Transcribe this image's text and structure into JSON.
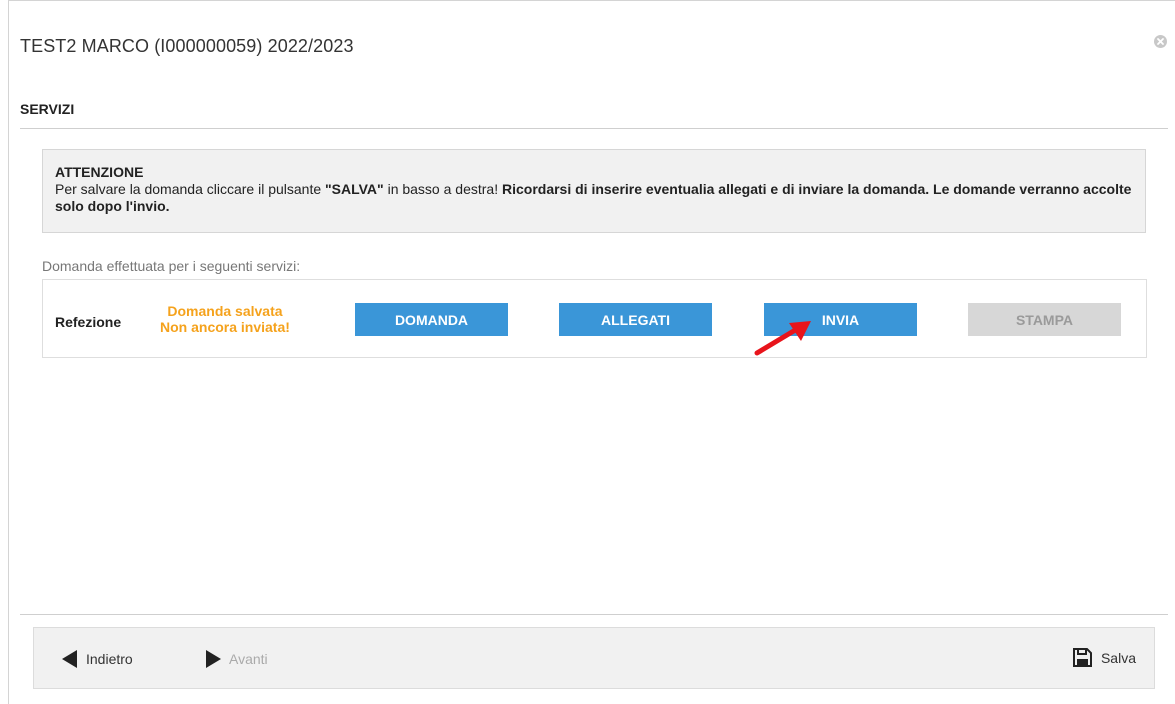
{
  "dialog": {
    "title": "TEST2 MARCO (I000000059) 2022/2023",
    "close_icon": "close-circle-icon"
  },
  "section": {
    "title": "SERVIZI"
  },
  "alert": {
    "heading": "ATTENZIONE",
    "text_part1": "Per salvare la domanda cliccare il pulsante ",
    "text_bold1": "\"SALVA\"",
    "text_part2": " in basso a destra! ",
    "text_bold2": "Ricordarsi di inserire eventualia allegati e di inviare la domanda. Le domande verranno accolte solo dopo l'invio."
  },
  "services_intro": "Domanda effettuata per i seguenti servizi:",
  "services": [
    {
      "name": "Refezione",
      "status_line1": "Domanda salvata",
      "status_line2": "Non ancora inviata!",
      "buttons": {
        "domanda": "DOMANDA",
        "allegati": "ALLEGATI",
        "invia": "INVIA",
        "stampa": "STAMPA"
      }
    }
  ],
  "footer": {
    "back_label": "Indietro",
    "next_label": "Avanti",
    "save_label": "Salva"
  },
  "colors": {
    "primary_button": "#3a96d8",
    "status_warning": "#f5a21c",
    "disabled_button": "#d7d7d7",
    "annotation_arrow": "#e8141b"
  }
}
